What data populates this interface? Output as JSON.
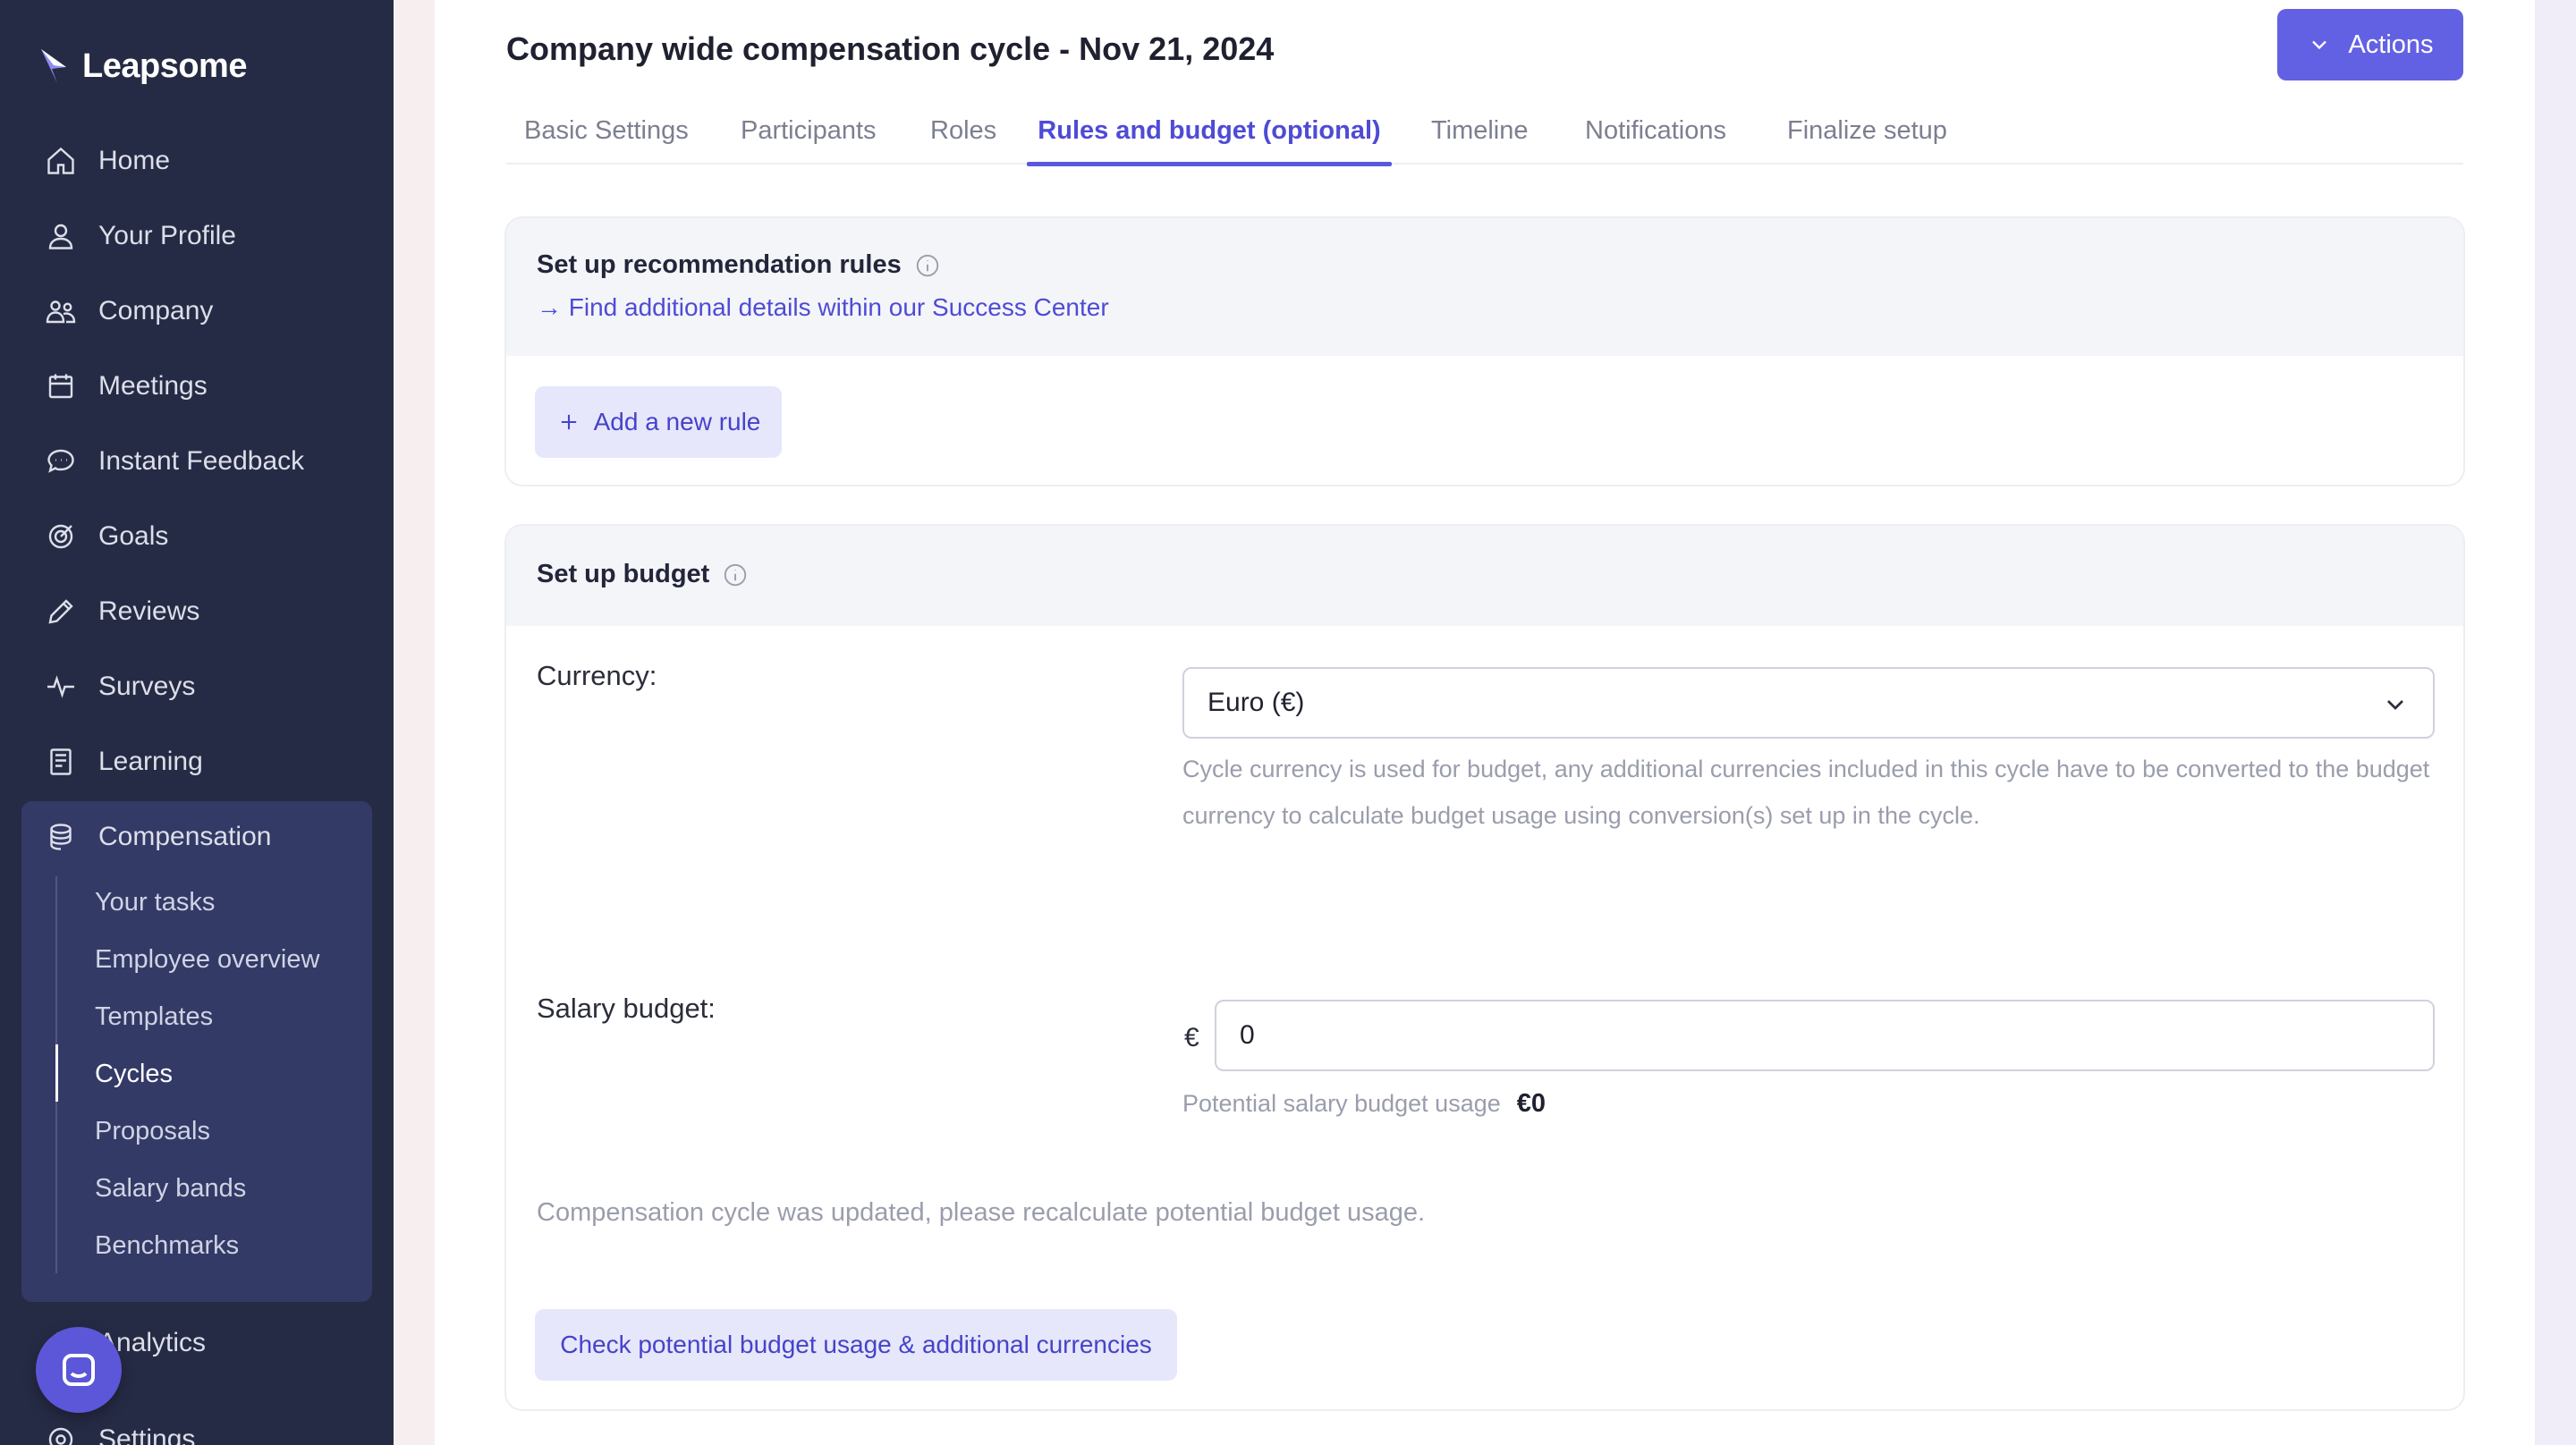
{
  "app": {
    "brand": "Leapsome"
  },
  "sidebar": {
    "items": [
      {
        "label": "Home",
        "icon": "home-icon"
      },
      {
        "label": "Your Profile",
        "icon": "user-icon"
      },
      {
        "label": "Company",
        "icon": "people-icon"
      },
      {
        "label": "Meetings",
        "icon": "calendar-icon"
      },
      {
        "label": "Instant Feedback",
        "icon": "chat-icon"
      },
      {
        "label": "Goals",
        "icon": "target-icon"
      },
      {
        "label": "Reviews",
        "icon": "pencil-icon"
      },
      {
        "label": "Surveys",
        "icon": "pulse-icon"
      },
      {
        "label": "Learning",
        "icon": "book-icon"
      },
      {
        "label": "Compensation",
        "icon": "coins-icon"
      }
    ],
    "compensation_sub": [
      {
        "label": "Your tasks"
      },
      {
        "label": "Employee overview"
      },
      {
        "label": "Templates"
      },
      {
        "label": "Cycles",
        "active": true
      },
      {
        "label": "Proposals"
      },
      {
        "label": "Salary bands"
      },
      {
        "label": "Benchmarks"
      }
    ],
    "after_items": [
      {
        "label": "Analytics",
        "icon": "chart-icon"
      },
      {
        "label": "Settings",
        "icon": "gear-icon"
      }
    ]
  },
  "header": {
    "title": "Company wide compensation cycle - Nov 21, 2024",
    "actions_label": "Actions"
  },
  "tabs": [
    {
      "label": "Basic Settings"
    },
    {
      "label": "Participants"
    },
    {
      "label": "Roles"
    },
    {
      "label": "Rules and budget (optional)",
      "active": true
    },
    {
      "label": "Timeline"
    },
    {
      "label": "Notifications"
    },
    {
      "label": "Finalize setup"
    }
  ],
  "rules_card": {
    "title": "Set up recommendation rules",
    "link": "→ Find additional details within our Success Center",
    "add_rule_label": "Add a new rule"
  },
  "budget_card": {
    "title": "Set up budget",
    "currency_label": "Currency:",
    "currency_value": "Euro (€)",
    "currency_helper": "Cycle currency is used for budget, any additional currencies included in this cycle have to be converted to the budget currency to calculate budget usage using conversion(s) set up in the cycle.",
    "salary_label": "Salary budget:",
    "currency_symbol": "€",
    "salary_value": "0",
    "usage_label": "Potential salary budget usage",
    "usage_value": "€0",
    "notice": "Compensation cycle was updated, please recalculate potential budget usage.",
    "check_button": "Check potential budget usage & additional currencies"
  },
  "colors": {
    "sidebar_bg": "#262b45",
    "accent": "#6361e3",
    "link": "#4e4bd6"
  }
}
